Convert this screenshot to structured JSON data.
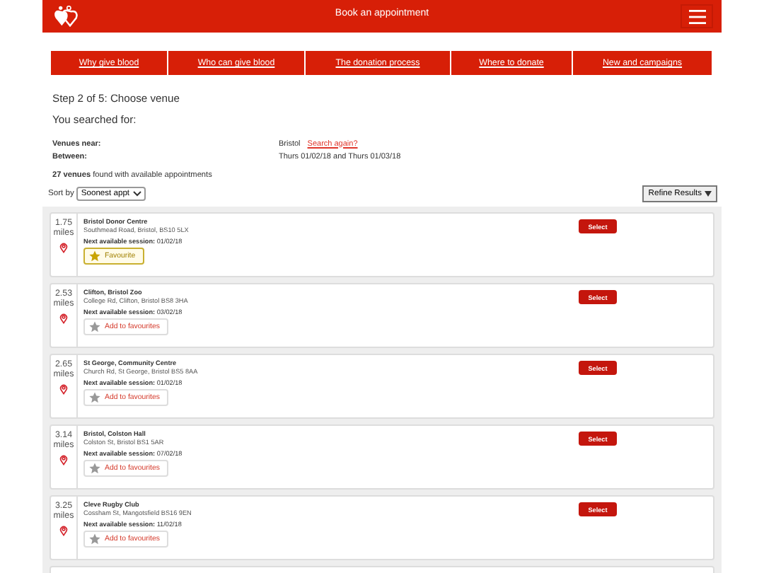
{
  "header": {
    "title": "Book an appointment"
  },
  "nav": [
    "Why give blood",
    "Who can give blood",
    "The donation process",
    "Where to donate",
    "New and campaigns"
  ],
  "step": "Step 2 of 5: Choose venue",
  "searched_heading": "You searched for:",
  "criteria": [
    {
      "label": "Venues near:",
      "value": "Bristol",
      "link": "Search again?"
    },
    {
      "label": "Between:",
      "value": "Thurs 01/02/18 and Thurs 01/03/18"
    }
  ],
  "results": {
    "count": "27 venues",
    "text": "found with available appointments"
  },
  "sort": {
    "label": "Sort by",
    "value": "Soonest appt"
  },
  "refine_button": "Refine Results",
  "venues": [
    {
      "distance": "1.75",
      "unit": "miles",
      "name": "Bristol Donor Centre",
      "address": "Southmead Road, Bristol, BS10 5LX",
      "session_label": "Next available session:",
      "session_date": "01/02/18",
      "favourite": true,
      "favourite_label": "Favourite",
      "select": "Select"
    },
    {
      "distance": "2.53",
      "unit": "miles",
      "name": "Clifton, Bristol Zoo",
      "address": "College Rd, Clifton, Bristol BS8 3HA",
      "session_label": "Next available session:",
      "session_date": "03/02/18",
      "favourite": false,
      "favourite_label": "Add to favourites",
      "select": "Select"
    },
    {
      "distance": "2.65",
      "unit": "miles",
      "name": "St George, Community Centre",
      "address": "Church Rd, St George, Bristol BS5 8AA",
      "session_label": "Next available session:",
      "session_date": "01/02/18",
      "favourite": false,
      "favourite_label": "Add to favourites",
      "select": "Select"
    },
    {
      "distance": "3.14",
      "unit": "miles",
      "name": "Bristol, Colston Hall",
      "address": "Colston St, Bristol BS1 5AR",
      "session_label": "Next available session:",
      "session_date": "07/02/18",
      "favourite": false,
      "favourite_label": "Add to favourites",
      "select": "Select"
    },
    {
      "distance": "3.25",
      "unit": "miles",
      "name": "Cleve Rugby Club",
      "address": "Cossham St, Mangotsfield BS16 9EN",
      "session_label": "Next available session:",
      "session_date": "11/02/18",
      "favourite": false,
      "favourite_label": "Add to favourites",
      "select": "Select"
    }
  ]
}
